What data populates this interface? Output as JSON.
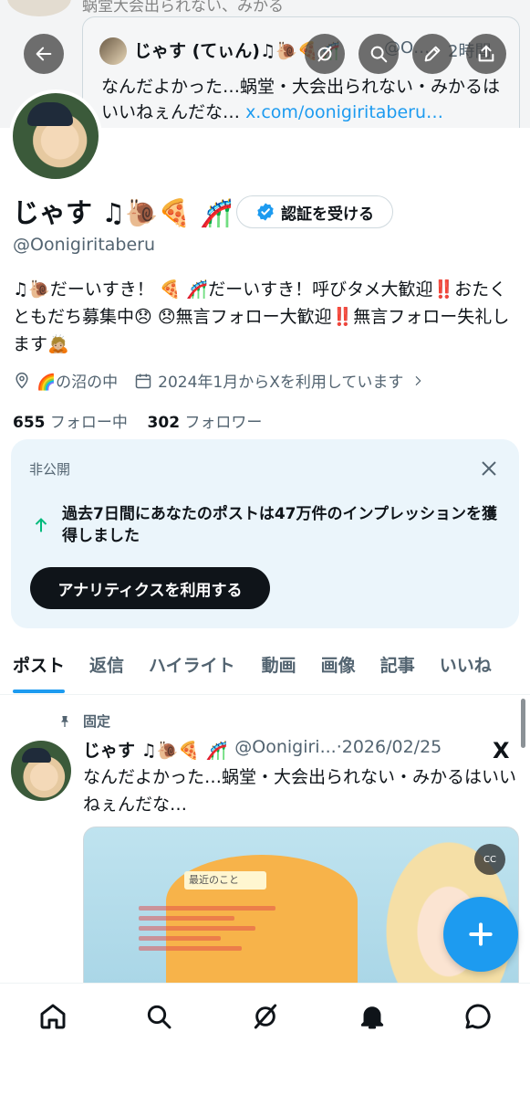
{
  "banner": {
    "top_text": "蜗堂大会出られない、みかる",
    "quote": {
      "name": "じゃす (てぃん)♫🐌🍕🎢",
      "handle": "@O…",
      "time": "2時間",
      "text": "なんだよかった…蜗堂・大会出られない・みかるはいいねぇんだな…",
      "link": "x.com/oonigiritaberu…"
    }
  },
  "header": {
    "back_icon": "arrow-left-icon",
    "grok_icon": "grok-icon",
    "search_icon": "search-icon",
    "edit_icon": "pencil-icon",
    "share_icon": "share-icon"
  },
  "profile": {
    "display_name": "じゃす ♫🐌🍕 🎢",
    "verify_label": "認証を受ける",
    "handle": "@Oonigiritaberu",
    "bio": "♫🐌だーいすき！ 🍕 🎢だーいすき！呼びタメ大歓迎‼️おたくともだち募集中😞 😞無言フォロー大歓迎‼️無言フォロー失礼します🙇🏼",
    "location": "🌈の沼の中",
    "joined": "2024年1月からXを利用しています",
    "following_count": "655",
    "following_label": "フォロー中",
    "followers_count": "302",
    "followers_label": "フォロワー"
  },
  "analytics": {
    "label": "非公開",
    "text": "過去7日間にあなたのポストは47万件のインプレッションを獲得しました",
    "button": "アナリティクスを利用する"
  },
  "tabs": [
    "ポスト",
    "返信",
    "ハイライト",
    "動画",
    "画像",
    "記事",
    "いいね"
  ],
  "tweet": {
    "pinned_label": "固定",
    "name": "じゃす ♫🐌🍕 🎢",
    "handle": "@Oonigiri...",
    "date": "·2026/02/25",
    "x_mark": "X",
    "text": "なんだよかった…蜗堂・大会出られない・みかるはいいねぇんだな…",
    "media_title": "最近のこと",
    "media_cc": "CC"
  },
  "colors": {
    "accent": "#1d9bf0",
    "text": "#0f1419",
    "secondary": "#536471",
    "analytics_bg": "#ebf5fb",
    "arrow_green": "#00ba7c"
  }
}
